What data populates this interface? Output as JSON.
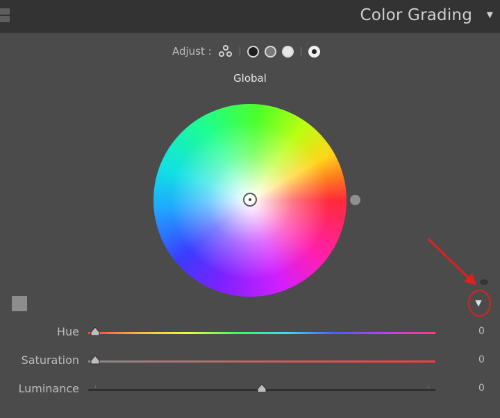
{
  "header": {
    "title": "Color Grading",
    "toggle_icon": "triangle-down-icon"
  },
  "adjust": {
    "label": "Adjust :",
    "modes": [
      {
        "name": "3-way",
        "icon": "three-circles-icon"
      },
      {
        "name": "shadows",
        "icon": "dark-circle-icon"
      },
      {
        "name": "midtones",
        "icon": "mid-circle-icon"
      },
      {
        "name": "highlights",
        "icon": "light-circle-icon"
      },
      {
        "name": "global",
        "icon": "global-circle-icon",
        "selected": true
      }
    ]
  },
  "wheel": {
    "title": "Global"
  },
  "sliders": [
    {
      "label": "Hue",
      "value": "0",
      "position_fraction": 0.02
    },
    {
      "label": "Saturation",
      "value": "0",
      "position_fraction": 0.02
    },
    {
      "label": "Luminance",
      "value": "0",
      "position_fraction": 0.5
    }
  ],
  "colors": {
    "panel": "#4b4b4b",
    "header": "#333333",
    "annotation": "#e02020"
  }
}
